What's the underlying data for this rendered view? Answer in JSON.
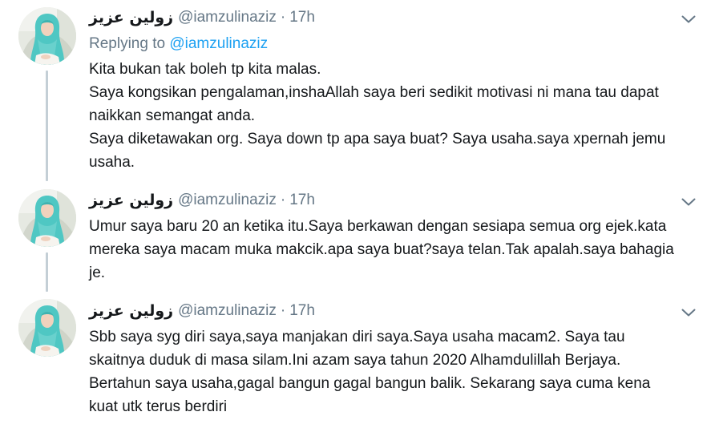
{
  "colors": {
    "name": "#14171a",
    "secondary": "#657786",
    "link": "#1da1f2",
    "thread_line": "#c4cfd6",
    "avatar_scarf": "#4fc7c3"
  },
  "icons": {
    "avatar": "profile-photo",
    "menu": "chevron-down-icon"
  },
  "tweets": [
    {
      "display_name": "زولين عزيز",
      "handle": "@iamzulinaziz",
      "separator": "·",
      "time": "17h",
      "reply_prefix": "Replying to",
      "reply_handle": "@iamzulinaziz",
      "paragraphs": [
        "Kita bukan tak boleh tp kita malas.",
        "Saya kongsikan pengalaman,inshaAllah saya beri sedikit motivasi ni mana tau dapat naikkan semangat anda.",
        "Saya diketawakan org. Saya down tp apa saya buat? Saya usaha.saya xpernah jemu usaha."
      ]
    },
    {
      "display_name": "زولين عزيز",
      "handle": "@iamzulinaziz",
      "separator": "·",
      "time": "17h",
      "paragraphs": [
        "Umur saya baru 20 an ketika itu.Saya berkawan dengan sesiapa semua org ejek.kata mereka saya macam muka makcik.apa saya buat?saya telan.Tak apalah.saya bahagia je."
      ]
    },
    {
      "display_name": "زولين عزيز",
      "handle": "@iamzulinaziz",
      "separator": "·",
      "time": "17h",
      "paragraphs": [
        "Sbb saya syg diri saya,saya manjakan diri saya.Saya usaha macam2. Saya tau skaitnya duduk di masa silam.Ini azam saya tahun 2020 Alhamdulillah Berjaya. Bertahun saya usaha,gagal bangun gagal bangun balik. Sekarang saya cuma kena kuat utk terus berdiri"
      ]
    }
  ]
}
